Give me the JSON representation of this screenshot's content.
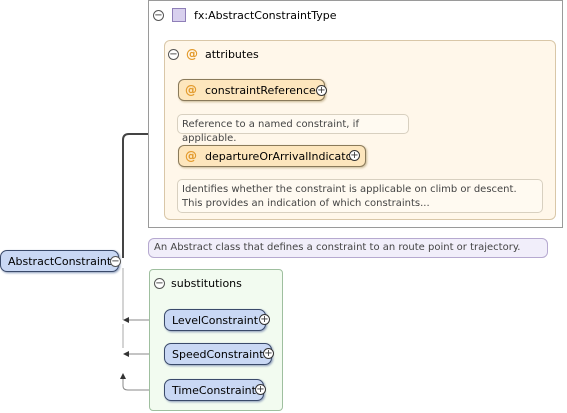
{
  "type_name": "fx:AbstractConstraintType",
  "attributes_label": "attributes",
  "attributes": [
    {
      "name": "constraintReference",
      "doc": "Reference to a named constraint, if applicable."
    },
    {
      "name": "departureOrArrivalIndicator",
      "doc": "Identifies whether the constraint is applicable on climb or descent. This provides an indication of which constraints..."
    }
  ],
  "type_annotation": "An Abstract class that defines a constraint to an route point or trajectory.",
  "root_element": "AbstractConstraint",
  "substitutions_label": "substitutions",
  "substitutions": [
    "LevelConstraint",
    "SpeedConstraint",
    "TimeConstraint"
  ],
  "icons": {
    "collapse": "minus-circle-icon",
    "expand": "plus-circle-icon",
    "type": "complex-type-icon",
    "attribute": "at-sign-icon",
    "arrow": "arrow-left-icon"
  }
}
